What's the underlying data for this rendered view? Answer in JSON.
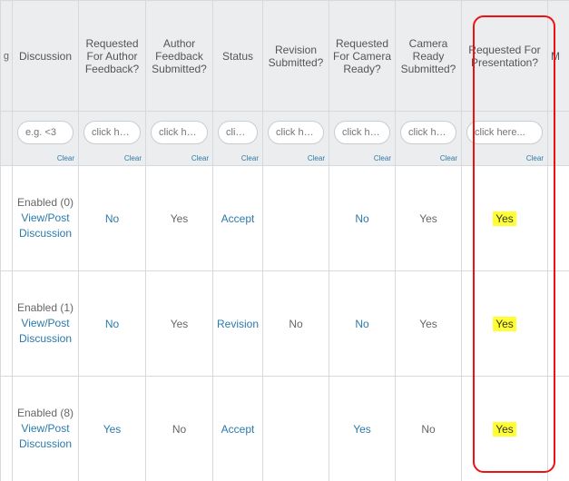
{
  "columns": {
    "leading_fragment": "g",
    "discussion": "Discussion",
    "req_author_feedback": "Requested For Author Feedback?",
    "author_feedback_submitted": "Author Feedback Submitted?",
    "status": "Status",
    "revision_submitted": "Revision Submitted?",
    "req_camera_ready": "Requested For Camera Ready?",
    "camera_ready_submitted": "Camera Ready Submitted?",
    "req_presentation": "Requested For Presentation?",
    "trailing_fragment": "M"
  },
  "filters": {
    "placeholder_eg": "e.g. <3",
    "placeholder_click": "click here...",
    "clear_label": "Clear"
  },
  "rows": [
    {
      "discussion_label": "Enabled (0)",
      "discussion_link": "View/Post Discussion",
      "req_author_feedback": "No",
      "author_feedback_submitted": "Yes",
      "status": "Accept",
      "revision_submitted": "",
      "req_camera_ready": "No",
      "camera_ready_submitted": "Yes",
      "req_presentation": "Yes"
    },
    {
      "discussion_label": "Enabled (1)",
      "discussion_link": "View/Post Discussion",
      "req_author_feedback": "No",
      "author_feedback_submitted": "Yes",
      "status": "Revision",
      "revision_submitted": "No",
      "req_camera_ready": "No",
      "camera_ready_submitted": "Yes",
      "req_presentation": "Yes"
    },
    {
      "discussion_label": "Enabled (8)",
      "discussion_link": "View/Post Discussion",
      "req_author_feedback": "Yes",
      "author_feedback_submitted": "No",
      "status": "Accept",
      "revision_submitted": "",
      "req_camera_ready": "Yes",
      "camera_ready_submitted": "No",
      "req_presentation": "Yes"
    }
  ]
}
